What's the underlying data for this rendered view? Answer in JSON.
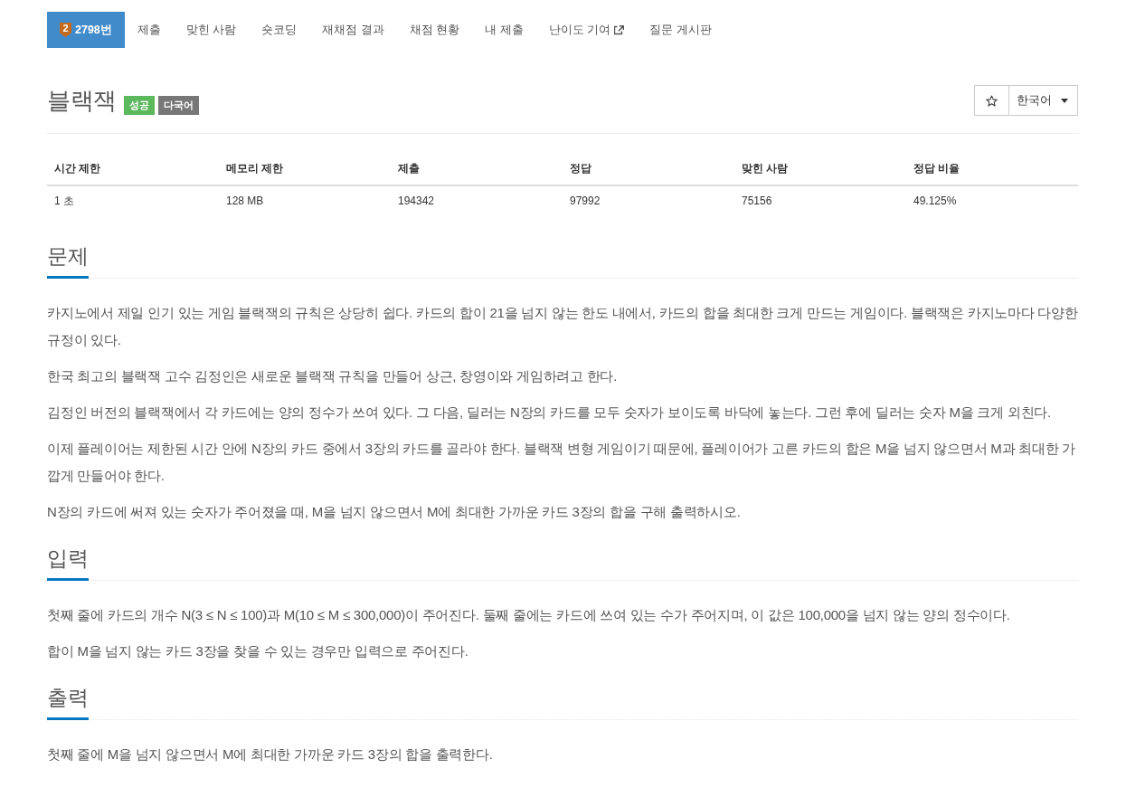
{
  "nav": {
    "tabs": [
      {
        "label": "2798번",
        "tier": "2",
        "selected": true,
        "external": false
      },
      {
        "label": "제출",
        "selected": false,
        "external": false
      },
      {
        "label": "맞힌 사람",
        "selected": false,
        "external": false
      },
      {
        "label": "숏코딩",
        "selected": false,
        "external": false
      },
      {
        "label": "재채점 결과",
        "selected": false,
        "external": false
      },
      {
        "label": "채점 현황",
        "selected": false,
        "external": false
      },
      {
        "label": "내 제출",
        "selected": false,
        "external": false
      },
      {
        "label": "난이도 기여",
        "selected": false,
        "external": true
      },
      {
        "label": "질문 게시판",
        "selected": false,
        "external": false
      }
    ]
  },
  "problem": {
    "title": "블랙잭",
    "labels": [
      {
        "text": "성공",
        "color": "#5cb85c"
      },
      {
        "text": "다국어",
        "color": "#777777"
      }
    ],
    "language": "한국어"
  },
  "info_table": {
    "columns": [
      "시간 제한",
      "메모리 제한",
      "제출",
      "정답",
      "맞힌 사람",
      "정답 비율"
    ],
    "rows": [
      [
        "1 초",
        "128 MB",
        "194342",
        "97992",
        "75156",
        "49.125%"
      ]
    ]
  },
  "sections": [
    {
      "title": "문제",
      "paragraphs": [
        "카지노에서 제일 인기 있는 게임 블랙잭의 규칙은 상당히 쉽다. 카드의 합이 21을 넘지 않는 한도 내에서, 카드의 합을 최대한 크게 만드는 게임이다. 블랙잭은 카지노마다 다양한 규정이 있다.",
        "한국 최고의 블랙잭 고수 김정인은 새로운 블랙잭 규칙을 만들어 상근, 창영이와 게임하려고 한다.",
        "김정인 버전의 블랙잭에서 각 카드에는 양의 정수가 쓰여 있다. 그 다음, 딜러는 N장의 카드를 모두 숫자가 보이도록 바닥에 놓는다. 그런 후에 딜러는 숫자 M을 크게 외친다.",
        "이제 플레이어는 제한된 시간 안에 N장의 카드 중에서 3장의 카드를 골라야 한다. 블랙잭 변형 게임이기 때문에, 플레이어가 고른 카드의 합은 M을 넘지 않으면서 M과 최대한 가깝게 만들어야 한다.",
        "N장의 카드에 써져 있는 숫자가 주어졌을 때, M을 넘지 않으면서 M에 최대한 가까운 카드 3장의 합을 구해 출력하시오."
      ]
    },
    {
      "title": "입력",
      "paragraphs": [
        "첫째 줄에 카드의 개수 N(3 ≤ N ≤ 100)과 M(10 ≤ M ≤ 300,000)이 주어진다. 둘째 줄에는 카드에 쓰여 있는 수가 주어지며, 이 값은 100,000을 넘지 않는 양의 정수이다.",
        "합이 M을 넘지 않는 카드 3장을 찾을 수 있는 경우만 입력으로 주어진다."
      ]
    },
    {
      "title": "출력",
      "paragraphs": [
        "첫째 줄에 M을 넘지 않으면서 M에 최대한 가까운 카드 3장의 합을 출력한다."
      ]
    }
  ]
}
